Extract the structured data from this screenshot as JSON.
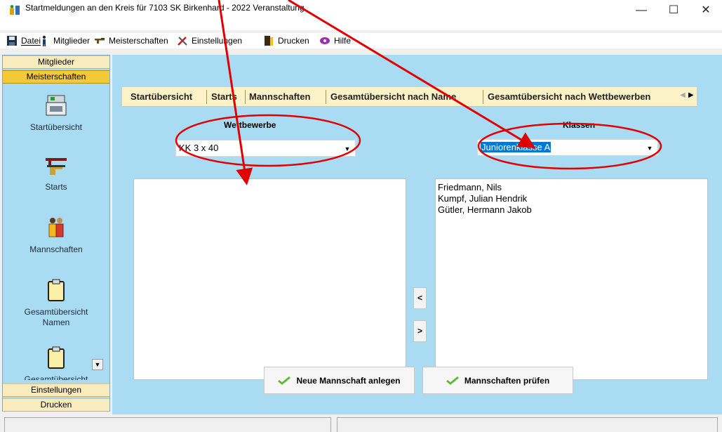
{
  "window": {
    "title": "Startmeldungen an den Kreis für 7103 SK Birkenhard - 2022   Veranstaltung",
    "minimize": "—",
    "maximize": "☐",
    "close": "✕"
  },
  "menu": [
    {
      "label": "Datei",
      "icon": "floppy-icon"
    },
    {
      "label": "Mitglieder",
      "icon": "person-icon"
    },
    {
      "label": "Meisterschaften",
      "icon": "rifle-icon"
    },
    {
      "label": "Einstellungen",
      "icon": "tools-icon"
    },
    {
      "label": "Drucken",
      "icon": "printer-icon"
    },
    {
      "label": "Hilfe",
      "icon": "help-icon"
    }
  ],
  "sidebar": {
    "sections_top": [
      "Mitglieder",
      "Meisterschaften"
    ],
    "items": [
      {
        "label": "Startübersicht",
        "icon": "register-icon"
      },
      {
        "label": "Starts",
        "icon": "rifle-icon"
      },
      {
        "label": "Mannschaften",
        "icon": "team-icon"
      },
      {
        "label": "Gesamtübersicht\nNamen",
        "icon": "clipboard-icon"
      },
      {
        "label": "Gesamtübersicht",
        "icon": "clipboard-icon"
      }
    ],
    "sections_bottom": [
      "Einstellungen",
      "Drucken"
    ]
  },
  "tabs": [
    "Startübersicht",
    "Starts",
    "Mannschaften",
    "Gesamtübersicht nach Name",
    "Gesamtübersicht nach Wettbewerben"
  ],
  "active_tab": "Mannschaften",
  "form": {
    "wettbewerbe_label": "Wettbewerbe",
    "wettbewerbe_value": "KK 3 x 40",
    "klassen_label": "Klassen",
    "klassen_value": "Juniorenklasse A"
  },
  "right_list": [
    "Friedmann, Nils",
    "Kumpf, Julian Hendrik",
    "Gütler, Hermann Jakob"
  ],
  "left_list": [],
  "move_left": "<",
  "move_right": ">",
  "buttons": {
    "new_team": "Neue Mannschaft anlegen",
    "check_teams": "Mannschaften prüfen"
  },
  "colors": {
    "panel": "#a9dcf3",
    "tabstrip": "#fbf3c7",
    "active_section": "#f5c83a",
    "annotation": "#e00000",
    "selection": "#0078d7"
  }
}
